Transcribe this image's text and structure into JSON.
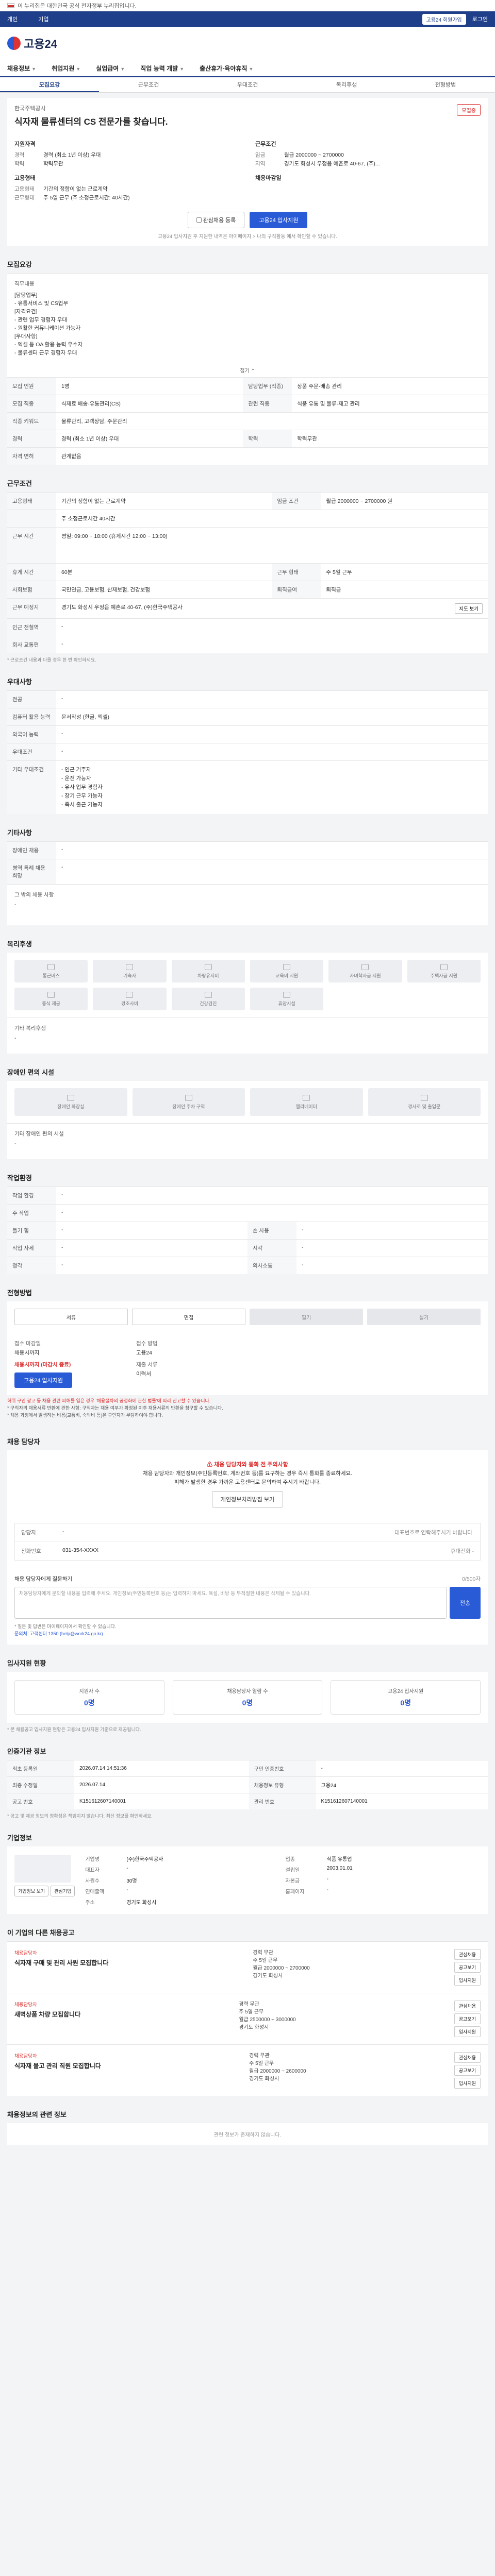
{
  "top": {
    "notice": "이 누리집은 대한민국 공식 전자정부 누리집입니다."
  },
  "gov": {
    "tab1": "개인",
    "tab2": "기업",
    "right1": "고용24 회원가입",
    "right2": "로그인"
  },
  "brand": {
    "name": "고용24"
  },
  "nav": [
    "채용정보",
    "취업지원",
    "실업급여",
    "직업 능력 개발",
    "출산휴가·육아휴직"
  ],
  "tabs": [
    "모집요강",
    "근무조건",
    "우대조건",
    "복리후생",
    "전형방법"
  ],
  "summary": {
    "company": "한국주택공사",
    "title": "식자재 물류센터의 CS 전문가를 찾습니다.",
    "badge": "모집중",
    "left_head": "지원자격",
    "left_kv": [
      [
        "경력",
        "경력 (최소 1년 이상) 우대"
      ],
      [
        "학력",
        "학력무관"
      ]
    ],
    "right_head": "근무조건",
    "right_kv": [
      [
        "임금",
        "월급 2000000 ~ 2700000"
      ],
      [
        "지역",
        "경기도 화성시 우정읍 예촌로 40-67, (주)..."
      ]
    ],
    "left_head2": "고용형태",
    "left_kv2": [
      [
        "고용형태",
        "기간의 정함이 없는 근로계약"
      ],
      [
        "근무형태",
        "주 5일 근무 (주 소정근로시간: 40시간)"
      ]
    ],
    "right_head2": "채용마감일",
    "btn_save": "관심채용 등록",
    "btn_apply": "고용24 입사지원",
    "note": "고용24 입사지원 후 지원한 내역은 마이페이지 > 나의 구직활동 에서 확인할 수 있습니다."
  },
  "recruit": {
    "title": "모집요강",
    "duty_label": "직무내용",
    "duty_text": [
      "[담당업무]",
      "- 유통서비스 및 CS업무",
      "[자격요건]",
      "- 관련 업무 경험자 우대",
      "- 원활한 커뮤니케이션 가능자",
      "[우대사항]",
      "- 엑셀 등 OA 활용 능력 우수자",
      "- 물류센터 근무 경험자 우대"
    ],
    "more": "접기 ⌃",
    "rows": [
      [
        "모집 인원",
        "1명",
        "담당업무 (직종)",
        "상품 주문·배송 관리"
      ],
      [
        "모집 직종",
        "식재료 배송·유통관리(CS)",
        "관련 직종",
        "식품 유통 및 물류·재고 관리"
      ],
      [
        "직종 키워드",
        "물류관리, 고객상담, 주문관리",
        "",
        ""
      ],
      [
        "경력",
        "경력 (최소 1년 이상) 우대",
        "학력",
        "학력무관"
      ],
      [
        "자격 면허",
        "관계없음",
        "",
        ""
      ]
    ]
  },
  "cond": {
    "title": "근무조건",
    "rows": [
      [
        "고용형태",
        "기간의 정함이 없는 근로계약",
        "임금 조건",
        "월급 2000000 ~ 2700000 원"
      ],
      [
        "",
        "주 소정근로시간 40시간",
        "",
        ""
      ],
      [
        "근무 시간",
        "평일: 09:00 ~ 18:00 (휴게시간 12:00 ~ 13:00)",
        "",
        ""
      ],
      [
        "휴게 시간",
        "60분",
        "근무 형태",
        "주 5일 근무"
      ],
      [
        "사회보험",
        "국민연금, 고용보험, 산재보험, 건강보험",
        "퇴직급여",
        "퇴직금"
      ],
      [
        "근무 예정지",
        "경기도 화성시 우정읍 예촌로 40-67, (주)한국주택공사",
        "",
        ""
      ],
      [
        "인근 전철역",
        "-",
        "",
        ""
      ],
      [
        "회사 교통편",
        "-",
        "",
        ""
      ]
    ],
    "map_btn": "지도 보기",
    "foot": "* 근로조건 내용과 다를 경우 한 번 확인하세요."
  },
  "pref": {
    "title": "우대사항",
    "rows": [
      [
        "전공",
        "-"
      ],
      [
        "컴퓨터 활용 능력",
        "문서작성 (한글, 엑셀)"
      ],
      [
        "외국어 능력",
        "-"
      ],
      [
        "우대조건",
        "-"
      ],
      [
        "기타 우대조건",
        "- 인근 거주자\n- 운전 가능자\n- 유사 업무 경험자\n- 장기 근무 가능자\n- 즉시 출근 가능자"
      ]
    ]
  },
  "etc": {
    "title": "기타사항",
    "rows": [
      [
        "장애인 채용",
        "-"
      ],
      [
        "병역 특례 채용 희망",
        "-"
      ]
    ],
    "extra_label": "그 밖의 채용 사항",
    "extra_value": "-"
  },
  "welfare": {
    "title": "복리후생",
    "chips": [
      "통근버스",
      "기숙사",
      "차량유지비",
      "교육비 지원",
      "자녀학자금 지원",
      "주택자금 지원",
      "중식 제공",
      "경조사비",
      "건강검진",
      "휴양시설"
    ],
    "other_label": "기타 복리후생",
    "other_value": "-"
  },
  "disabled": {
    "title": "장애인 편의 시설",
    "chips": [
      "장애인 화장실",
      "장애인 주차 구역",
      "엘리베이터",
      "경사로 및 출입문"
    ],
    "other_label": "기타 장애인 편의 시설",
    "other_value": "-"
  },
  "env": {
    "title": "작업환경",
    "rows": [
      [
        "작업 환경",
        "-",
        "",
        ""
      ],
      [
        "주 작업",
        "-",
        "",
        ""
      ],
      [
        "들기 힘",
        "-",
        "손 사용",
        "-"
      ],
      [
        "작업 자세",
        "-",
        "시각",
        "-"
      ],
      [
        "청각",
        "-",
        "의사소통",
        "-"
      ]
    ]
  },
  "process": {
    "title": "전형방법",
    "steps": [
      "서류",
      "면접",
      "필기",
      "실기"
    ],
    "apply_label1": "접수 마감일",
    "apply_value1": "채용시까지",
    "apply_label2": "접수 방법",
    "apply_value2": "고용24",
    "apply_red": "채용시까지 (마감시 종료)",
    "docs_label": "제출 서류",
    "docs_value": "이력서",
    "btn": "고용24 입사지원",
    "notes": [
      "허위 구인 광고 등 채용 관련 피해를 입은 경우 ‘채용절차의 공정화에 관한 법률’에 따라 신고할 수 있습니다.",
      "* 구직자의 채용서류 반환에 관한 사항: 구직자는 채용 여부가 확정된 이후 채용서류의 반환을 청구할 수 있습니다.",
      "* 채용 과정에서 발생하는 비용(교통비, 숙박비 등)은 구인자가 부담하여야 합니다."
    ]
  },
  "manager": {
    "title": "채용 담당자",
    "warn": "채용 담당자와 통화 전 주의사항",
    "text1": "채용 담당자와 개인정보(주민등록번호, 계좌번호 등)를 요구하는 경우 즉시 통화를 종료하세요.",
    "text2": "피해가 발생한 경우 가까운 고용센터로 문의하여 주시기 바랍니다.",
    "btn": "개인정보처리방침 보기",
    "rows": [
      [
        "담당자",
        "-",
        "대표번호로 연락해주시기 바랍니다."
      ],
      [
        "전화번호",
        "031-354-XXXX",
        "휴대전화 -"
      ]
    ],
    "inquiry_label": "채용 담당자에게 질문하기",
    "inquiry_count": "0/500자",
    "inquiry_placeholder": "채용담당자에게 문의할 내용을 입력해 주세요. 개인정보(주민등록번호 등)는 입력하지 마세요. 욕설, 비방 등 부적절한 내용은 삭제될 수 있습니다.",
    "inquiry_send": "전송",
    "inq_notes": [
      "* 질문 및 답변은 마이페이지에서 확인할 수 있습니다.",
      "문의처: 고객센터 1350 (help@work24.go.kr)"
    ]
  },
  "stats": {
    "title": "입사지원 현황",
    "items": [
      [
        "지원자 수",
        "0명"
      ],
      [
        "채용담당자 열람 수",
        "0명"
      ],
      [
        "고용24 입사지원",
        "0명"
      ]
    ],
    "note": "* 본 채용공고 입사지원 현황은 고용24 입사지원 기준으로 제공됩니다."
  },
  "meta": {
    "title": "인증기관 정보",
    "rows": [
      [
        "최초 등록일",
        "2026.07.14 14:51:36",
        "구인 인증번호",
        "-"
      ],
      [
        "최종 수정일",
        "2026.07.14",
        "채용정보 유형",
        "고용24"
      ],
      [
        "공고 번호",
        "K151612607140001",
        "관리 번호",
        "K151612607140001"
      ]
    ],
    "note": "* 공고 및 제공 정보의 정확성은 책임지지 않습니다. 최신 정보를 확인하세요."
  },
  "company": {
    "title": "기업정보",
    "btn1": "기업정보 보기",
    "btn2": "관심기업",
    "rows": [
      [
        "기업명",
        "(주)한국주택공사",
        "업종",
        "식품 유통업"
      ],
      [
        "대표자",
        "-",
        "설립일",
        "2003.01.01"
      ],
      [
        "사원수",
        "30명",
        "자본금",
        "-"
      ],
      [
        "연매출액",
        "-",
        "홈페이지",
        "-"
      ],
      [
        "주소",
        "경기도 화성시",
        "",
        ""
      ]
    ]
  },
  "others": {
    "title": "이 기업의 다른 채용공고",
    "items": [
      {
        "co": "채용담당자",
        "title": "식자재 구매 및 관리 사원 모집합니다",
        "facts": [
          "경력 무관",
          "주 5일 근무",
          "월급 2000000 ~ 2700000",
          "경기도 화성시"
        ]
      },
      {
        "co": "채용담당자",
        "title": "새벽상품 차량 모집합니다",
        "facts": [
          "경력 무관",
          "주 5일 근무",
          "월급 2500000 ~ 3000000",
          "경기도 화성시"
        ]
      },
      {
        "co": "채용담당자",
        "title": "식자재 물고 관리 직원 모집합니다",
        "facts": [
          "경력 무관",
          "주 5일 근무",
          "월급 2000000 ~ 2600000",
          "경기도 화성시"
        ]
      }
    ],
    "actions": [
      "관심채용",
      "공고보기",
      "입사지원"
    ]
  },
  "similar": {
    "title": "채용정보의 관련 정보",
    "empty": "관련 정보가 존재하지 않습니다."
  }
}
